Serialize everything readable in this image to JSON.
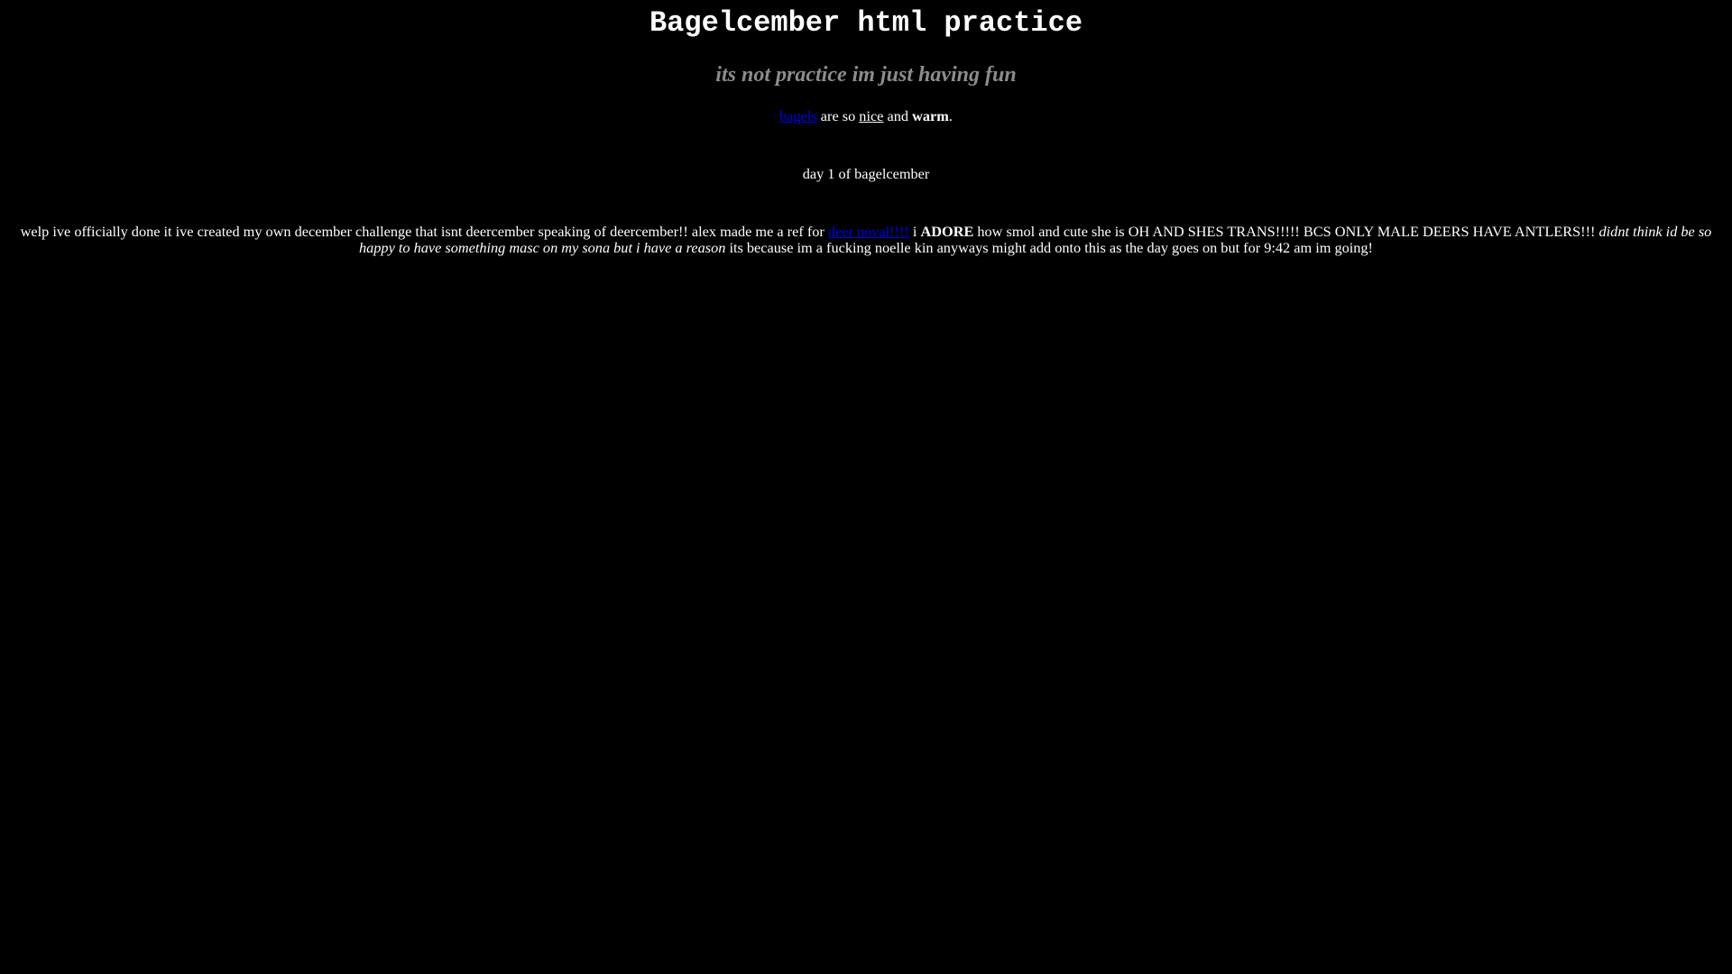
{
  "header": {
    "title": "Bagelcember html practice",
    "subtitle": "its not practice im just having fun"
  },
  "intro": {
    "link_text": "bagels",
    "t1": " are so ",
    "underlined": "nice",
    "t2": " and ",
    "bold": "warm",
    "t3": "."
  },
  "day_heading": "day 1 of bagelcember",
  "entry": {
    "t1": "welp ive officially done it ive created my own december challenge that isnt deercember speaking of deercember!! alex made me a ref for ",
    "link_text": "deer noval!!!!",
    "t2": " i ",
    "bold": "ADORE",
    "t3": " how smol and cute she is OH AND SHES TRANS!!!!! BCS ONLY MALE DEERS HAVE ANTLERS!!! ",
    "italic": "didnt think id be so happy to have something masc on my sona but i have a reason",
    "t4": " its because im a fucking noelle kin anyways might add onto this as the day goes on but for 9:42 am im going!"
  }
}
